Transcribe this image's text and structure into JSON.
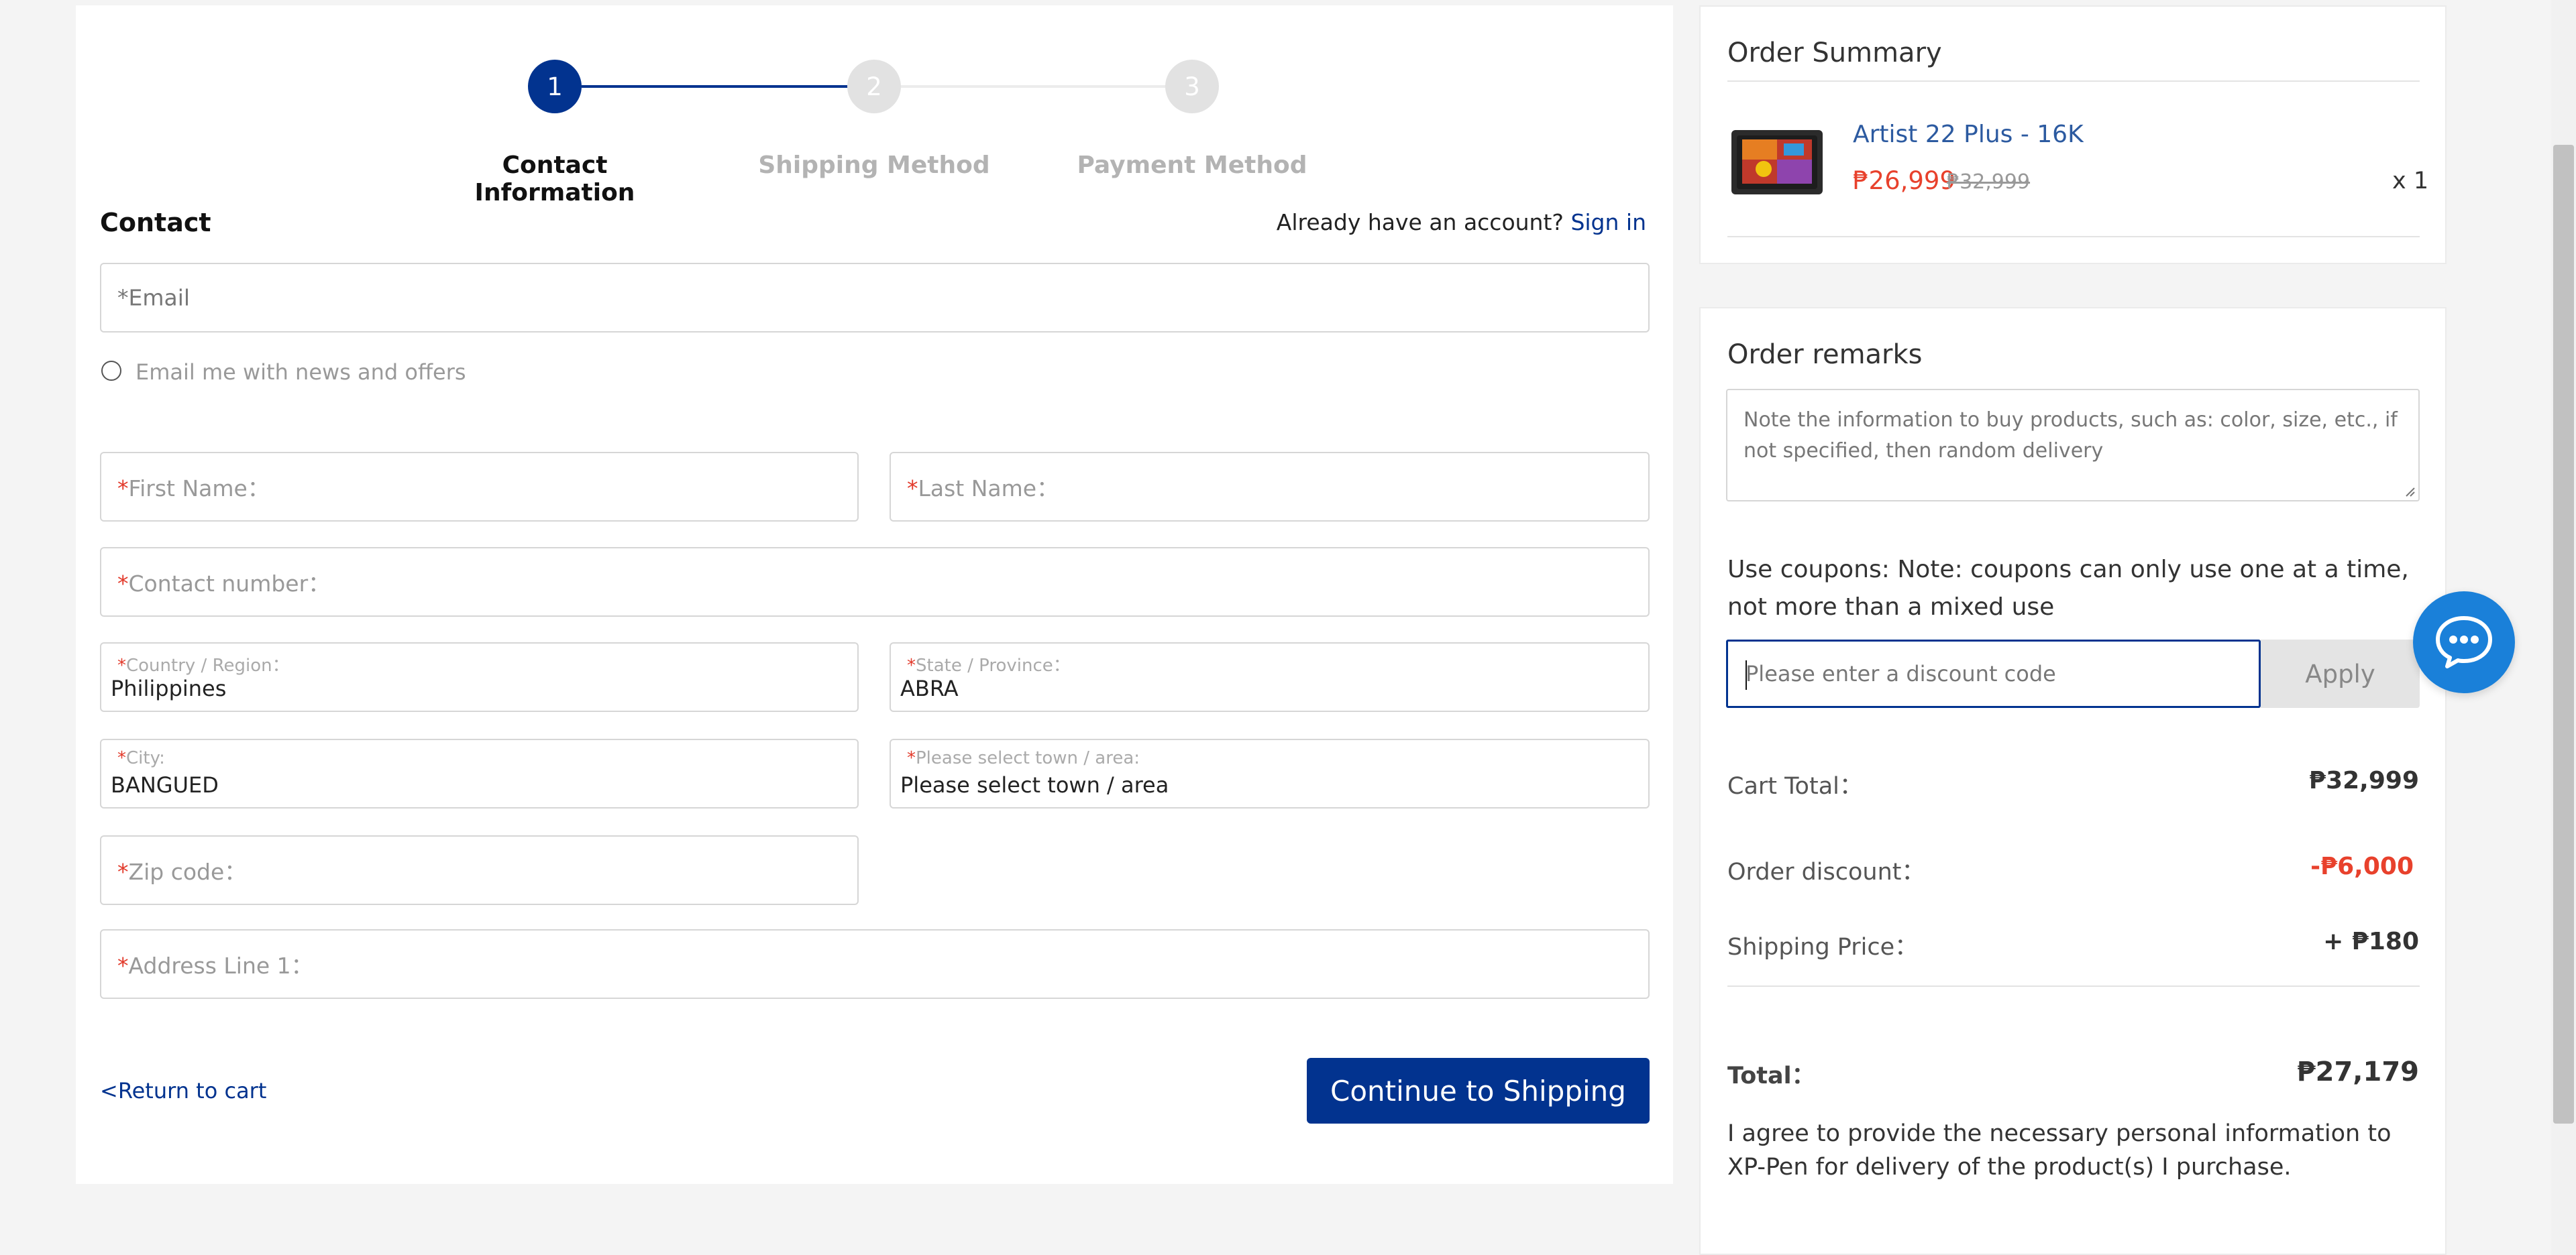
{
  "steps": [
    {
      "number": "1",
      "label": "Contact Information",
      "active": true
    },
    {
      "number": "2",
      "label": "Shipping Method",
      "active": false
    },
    {
      "number": "3",
      "label": "Payment Method",
      "active": false
    }
  ],
  "contact": {
    "heading": "Contact",
    "account_prompt": "Already have an account?",
    "sign_in": "Sign in",
    "email_placeholder": "*Email",
    "newsletter_label": "Email me with news and offers"
  },
  "form": {
    "first_name": {
      "req": "*",
      "label": "First Name："
    },
    "last_name": {
      "req": "*",
      "label": "Last Name："
    },
    "contact_number": {
      "req": "*",
      "label": "Contact number："
    },
    "country": {
      "req": "*",
      "label": "Country / Region：",
      "value": "Philippines"
    },
    "state": {
      "req": "*",
      "label": "State / Province：",
      "value": "ABRA"
    },
    "city": {
      "req": "*",
      "label": "City:",
      "value": "BANGUED"
    },
    "town": {
      "req": "*",
      "label": "Please select town / area:",
      "value": "Please select town / area"
    },
    "zip": {
      "req": "*",
      "label": "Zip code："
    },
    "address1": {
      "req": "*",
      "label": "Address Line 1："
    }
  },
  "actions": {
    "return_to_cart": "<Return to cart",
    "continue": "Continue to Shipping"
  },
  "summary": {
    "heading": "Order Summary",
    "product": {
      "name": "Artist 22 Plus - 16K",
      "price": "₱26,999",
      "original_price": "₱32,999",
      "qty": "x 1"
    }
  },
  "remarks": {
    "heading": "Order remarks",
    "placeholder": "Note the information to buy products, such as: color, size, etc., if not specified, then random delivery",
    "coupon_note": "Use coupons: Note: coupons can only use one at a time, not more than a mixed use",
    "coupon_placeholder": "Please enter a discount code",
    "apply": "Apply"
  },
  "totals": {
    "cart_total_label": "Cart Total：",
    "cart_total": "₱32,999",
    "discount_label": "Order discount：",
    "discount": "-₱6,000",
    "shipping_label": "Shipping Price：",
    "shipping": "+ ₱180",
    "total_label": "Total：",
    "total": "₱27,179",
    "agreement": "I agree to provide the necessary personal information to XP-Pen for delivery of the product(s) I purchase."
  },
  "colors": {
    "primary": "#02338f",
    "price_red": "#e8412c",
    "inactive": "#e2e2e2"
  },
  "icons": [
    "chat-icon",
    "product-thumbnail"
  ]
}
